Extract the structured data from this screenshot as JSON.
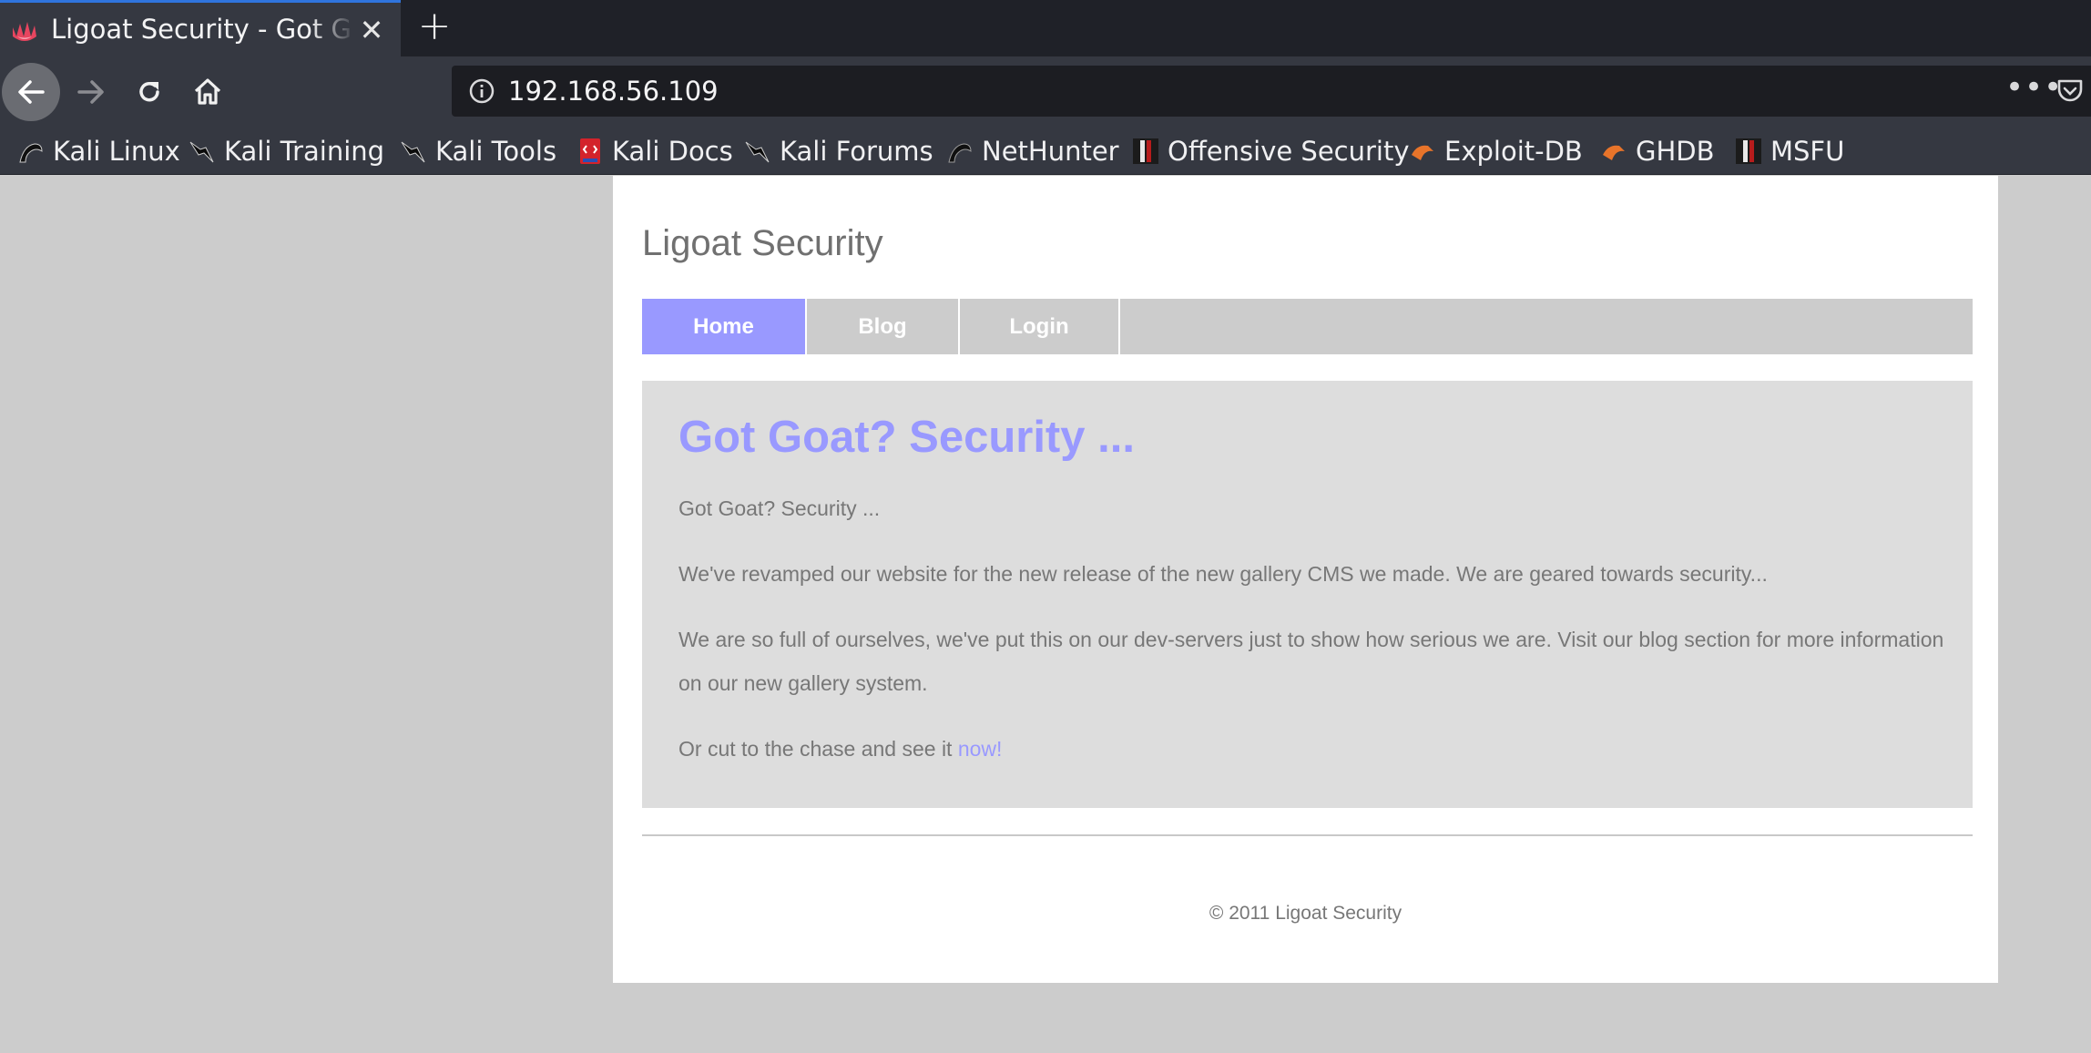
{
  "browser": {
    "tab_title": "Ligoat Security - Got Goat? Security ...",
    "url": "192.168.56.109",
    "new_tab_label": "+",
    "close_label": "✕",
    "more_label": "•••",
    "bookmarks": [
      {
        "label": "Kali Linux",
        "icon": "kali-dragon-icon"
      },
      {
        "label": "Kali Training",
        "icon": "kali-dragon-icon"
      },
      {
        "label": "Kali Tools",
        "icon": "kali-dragon-icon"
      },
      {
        "label": "Kali Docs",
        "icon": "kali-docs-icon"
      },
      {
        "label": "Kali Forums",
        "icon": "kali-dragon-icon"
      },
      {
        "label": "NetHunter",
        "icon": "nethunter-icon"
      },
      {
        "label": "Offensive Security",
        "icon": "offsec-icon"
      },
      {
        "label": "Exploit-DB",
        "icon": "exploit-db-icon"
      },
      {
        "label": "GHDB",
        "icon": "ghdb-icon"
      },
      {
        "label": "MSFU",
        "icon": "msfu-icon"
      }
    ],
    "colors": {
      "tab_accent": "#2f74dd",
      "chrome_bg": "#353841",
      "url_bg": "#1c1d22"
    }
  },
  "site": {
    "title": "Ligoat Security",
    "menu": [
      {
        "label": "Home",
        "active": true
      },
      {
        "label": "Blog",
        "active": false
      },
      {
        "label": "Login",
        "active": false
      }
    ],
    "headline": "Got Goat? Security ...",
    "paragraphs": [
      "Got Goat? Security ...",
      "We've revamped our website for the new release of the new gallery CMS we made. We are geared towards security...",
      "We are so full of ourselves, we've put this on our dev-servers just to show how serious we are. Visit our blog section for more information on our new gallery system."
    ],
    "cta_text": "Or cut to the chase and see it ",
    "cta_link": "now!",
    "footer": "© 2011 Ligoat Security",
    "colors": {
      "accent": "#9999ff",
      "menu_bg": "#cccccc",
      "content_bg": "#dddddd",
      "text": "#777777"
    }
  }
}
